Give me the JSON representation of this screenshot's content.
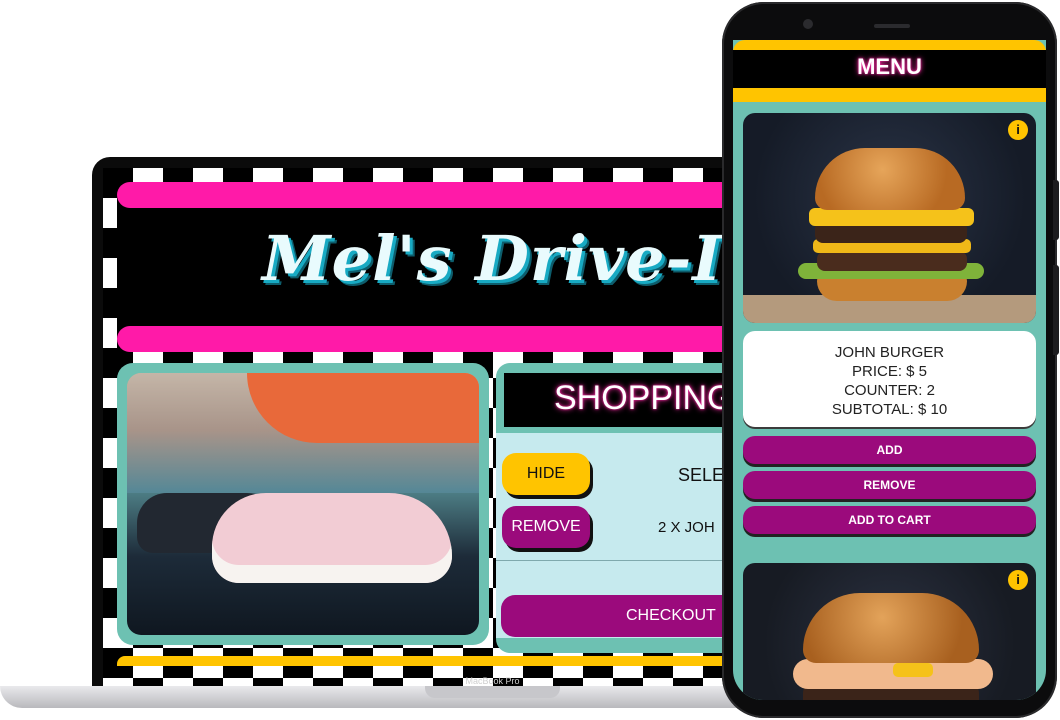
{
  "laptop": {
    "model_label": "MacBook Pro",
    "logo_text": "Mel's Drive-In",
    "cart": {
      "title": "SHOPPING",
      "hide_label": "HIDE",
      "remove_label": "REMOVE",
      "selected_text": "SELE",
      "item_text": "2 X JOH",
      "checkout_label": "CHECKOUT"
    }
  },
  "phone": {
    "menu_title": "MENU",
    "product": {
      "name": "JOHN BURGER",
      "price": "PRICE: $ 5",
      "counter": "COUNTER: 2",
      "subtotal": "SUBTOTAL: $ 10"
    },
    "buttons": {
      "add": "ADD",
      "remove": "REMOVE",
      "add_to_cart": "ADD TO CART"
    },
    "info_glyph": "i"
  },
  "colors": {
    "pink": "#ff1aa8",
    "teal": "#6dc1b2",
    "yellow": "#ffc400",
    "purple": "#9b0a7c",
    "light_cyan": "#c6eaee"
  },
  "icons": [
    "info-icon",
    "camera-icon"
  ]
}
